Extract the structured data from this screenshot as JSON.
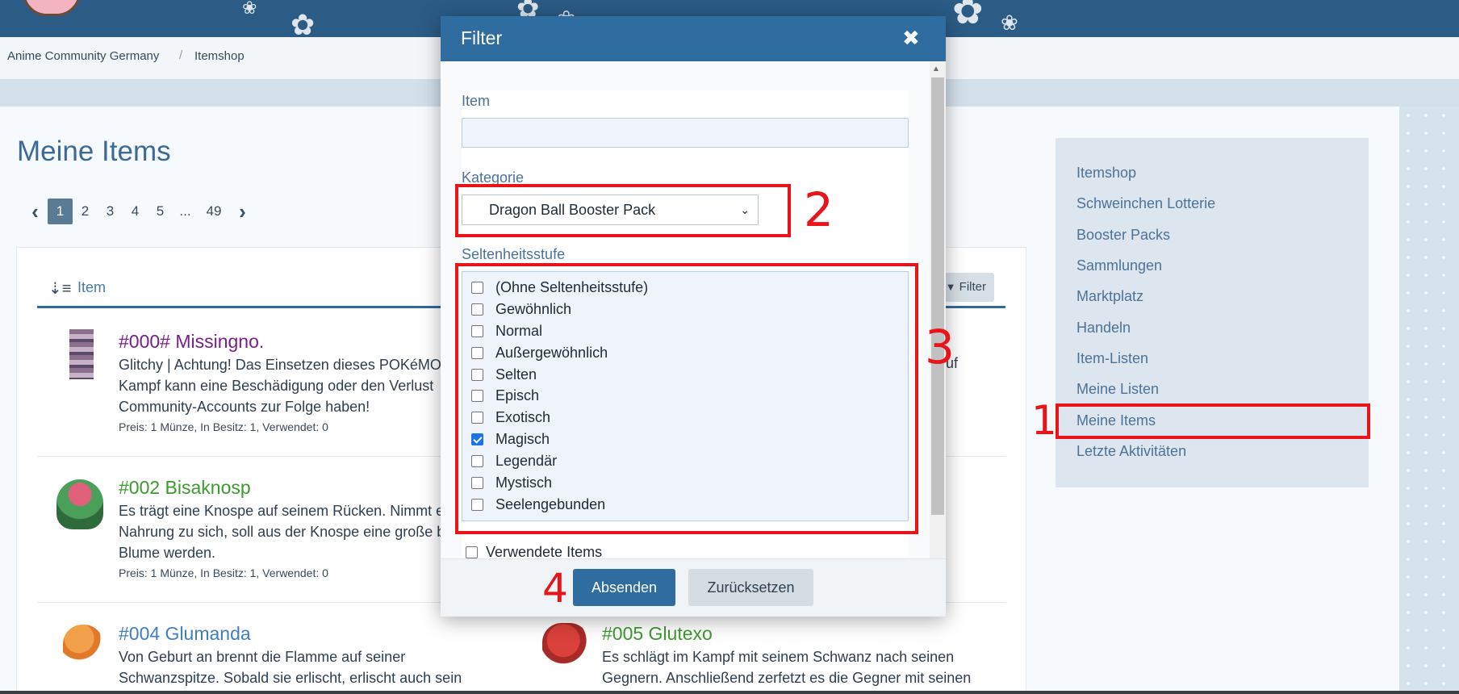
{
  "breadcrumb": [
    "Anime Community Germany",
    "Itemshop"
  ],
  "page": {
    "title": "Meine Items"
  },
  "pagination": {
    "pages": [
      "1",
      "2",
      "3",
      "4",
      "5",
      "...",
      "49"
    ],
    "active": "1"
  },
  "list": {
    "column_label": "Item",
    "filter_button": "Filter",
    "items": [
      {
        "title": "#000# Missingno.",
        "title_color": "#7a1f8a",
        "desc_lines": [
          "Glitchy | Achtung! Das Einsetzen dieses POKéMO",
          "Kampf kann eine Beschädigung oder den Verlust",
          "Community-Accounts zur Folge haben!"
        ],
        "meta": "Preis: 1 Münze, In Besitz: 1, Verwendet: 0"
      },
      {
        "title": "#002 Bisaknosp",
        "title_color": "#3c9a2e",
        "desc_lines": [
          "Es trägt eine Knospe auf seinem Rücken. Nimmt e",
          "Nahrung zu sich, soll aus der Knospe eine große b",
          "Blume werden."
        ],
        "meta": "Preis: 1 Münze, In Besitz: 1, Verwendet: 0"
      },
      {
        "title": "#004 Glumanda",
        "title_color": "#3f7fc0",
        "desc_lines": [
          "Von Geburt an brennt die Flamme auf seiner",
          "Schwanzspitze. Sobald sie erlischt, erlischt auch sein"
        ],
        "meta": ""
      },
      {
        "title": "#005 Glutexo",
        "title_color": "#3c9a2e",
        "desc_lines": [
          "Es schlägt im Kampf mit seinem Schwanz nach seinen",
          "Gegnern. Anschließend zerfetzt es die Gegner mit seinen"
        ],
        "meta": ""
      }
    ],
    "peek_text": "uf"
  },
  "sidebar": {
    "items": [
      "Itemshop",
      "Schweinchen Lotterie",
      "Booster Packs",
      "Sammlungen",
      "Marktplatz",
      "Handeln",
      "Item-Listen",
      "Meine Listen",
      "Meine Items",
      "Letzte Aktivitäten"
    ],
    "active": "Meine Items"
  },
  "modal": {
    "title": "Filter",
    "close_icon": "close-icon",
    "item_label": "Item",
    "item_value": "",
    "category_label": "Kategorie",
    "category_value": "Dragon Ball Booster Pack",
    "rarity_label": "Seltenheitsstufe",
    "rarities": [
      {
        "label": "(Ohne Seltenheitsstufe)",
        "checked": false
      },
      {
        "label": "Gewöhnlich",
        "checked": false
      },
      {
        "label": "Normal",
        "checked": false
      },
      {
        "label": "Außergewöhnlich",
        "checked": false
      },
      {
        "label": "Selten",
        "checked": false
      },
      {
        "label": "Episch",
        "checked": false
      },
      {
        "label": "Exotisch",
        "checked": false
      },
      {
        "label": "Magisch",
        "checked": true
      },
      {
        "label": "Legendär",
        "checked": false
      },
      {
        "label": "Mystisch",
        "checked": false
      },
      {
        "label": "Seelengebunden",
        "checked": false
      }
    ],
    "used_items_label": "Verwendete Items",
    "used_items_checked": false,
    "submit_label": "Absenden",
    "reset_label": "Zurücksetzen"
  },
  "annotations": [
    "1",
    "2",
    "3",
    "4"
  ],
  "colors": {
    "accent": "#2f6da0",
    "highlight": "#e8141a",
    "link": "#4b7399"
  }
}
